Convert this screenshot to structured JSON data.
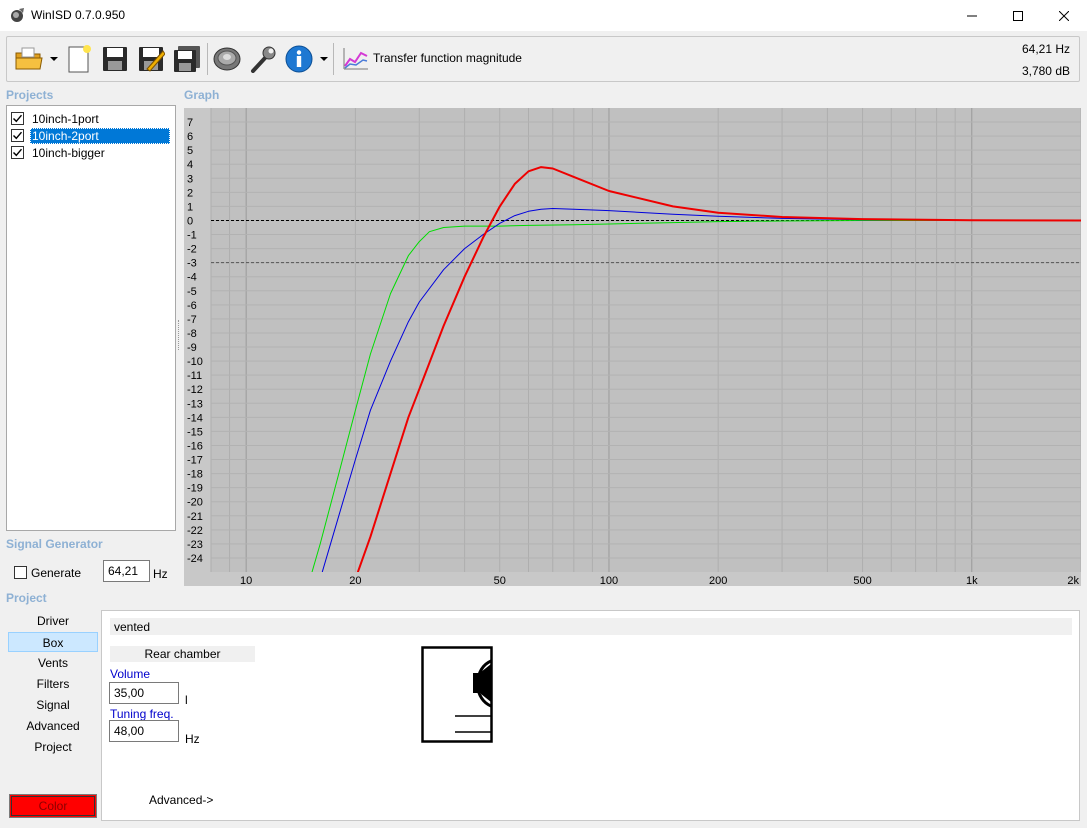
{
  "window": {
    "title": "WinISD 0.7.0.950",
    "minimize_glyph": "—",
    "maximize_glyph": "☐",
    "close_glyph": "✕"
  },
  "toolbar": {
    "buttons": [
      "open-folder-icon",
      "new-project-icon",
      "save-icon",
      "save-as-icon",
      "save-all-icon",
      "driver-icon",
      "tools-icon",
      "info-icon",
      "graph-type-icon"
    ],
    "graph_type_label": "Transfer function magnitude",
    "readout_frequency": "64,21 Hz",
    "readout_level": "3,780 dB"
  },
  "projects": {
    "header": "Projects",
    "items": [
      {
        "label": "10inch-1port",
        "checked": true,
        "selected": false
      },
      {
        "label": "10inch-2port",
        "checked": true,
        "selected": true
      },
      {
        "label": "10inch-bigger",
        "checked": true,
        "selected": false
      }
    ]
  },
  "graph": {
    "header": "Graph"
  },
  "signal_generator": {
    "header": "Signal Generator",
    "generate_label": "Generate",
    "generate_checked": false,
    "frequency_value": "64,21",
    "frequency_unit": "Hz"
  },
  "project_panel": {
    "header": "Project",
    "nav": [
      "Driver",
      "Box",
      "Vents",
      "Filters",
      "Signal",
      "Advanced",
      "Project"
    ],
    "nav_selected": "Box",
    "color_button_label": "Color",
    "color_button_color": "#ff0000",
    "box_type": "vented",
    "rear_chamber_label": "Rear chamber",
    "volume_label": "Volume",
    "volume_value": "35,00",
    "volume_unit": "l",
    "tuning_label": "Tuning freq.",
    "tuning_value": "48,00",
    "tuning_unit": "Hz",
    "advanced_link": "Advanced->"
  },
  "chart_data": {
    "type": "line",
    "x_scale": "log",
    "xlim": [
      8,
      2000
    ],
    "ylim": [
      -25,
      8
    ],
    "x_tick_labels": [
      {
        "value": 10,
        "label": "10"
      },
      {
        "value": 20,
        "label": "20"
      },
      {
        "value": 50,
        "label": "50"
      },
      {
        "value": 100,
        "label": "100"
      },
      {
        "value": 200,
        "label": "200"
      },
      {
        "value": 500,
        "label": "500"
      },
      {
        "value": 1000,
        "label": "1k"
      },
      {
        "value": 2000,
        "label": "2k"
      }
    ],
    "y_ticks": [
      7,
      6,
      5,
      4,
      3,
      2,
      1,
      0,
      -1,
      -2,
      -3,
      -4,
      -5,
      -6,
      -7,
      -8,
      -9,
      -10,
      -11,
      -12,
      -13,
      -14,
      -15,
      -16,
      -17,
      -18,
      -19,
      -20,
      -21,
      -22,
      -23,
      -24
    ],
    "reference_lines": [
      {
        "y": 0,
        "color": "#000000"
      },
      {
        "y": -3,
        "color": "#555555"
      }
    ],
    "background_color": "#c0c0c0",
    "grid": true,
    "series": [
      {
        "color": "#00dd00",
        "width": 1,
        "x": [
          15,
          16,
          18,
          20,
          22,
          25,
          28,
          30,
          32,
          35,
          40,
          45,
          50,
          60,
          80,
          100,
          150,
          200,
          300,
          500,
          1000,
          2000
        ],
        "y": [
          -25.5,
          -23,
          -18,
          -13.5,
          -9.5,
          -5.2,
          -2.5,
          -1.5,
          -0.8,
          -0.5,
          -0.4,
          -0.4,
          -0.4,
          -0.35,
          -0.3,
          -0.25,
          -0.15,
          -0.08,
          -0.04,
          0,
          0,
          0
        ]
      },
      {
        "color": "#0000dd",
        "width": 1,
        "x": [
          16,
          18,
          20,
          22,
          25,
          28,
          30,
          35,
          40,
          45,
          50,
          55,
          60,
          65,
          70,
          80,
          100,
          150,
          200,
          300,
          500,
          1000,
          2000
        ],
        "y": [
          -25.5,
          -21,
          -17,
          -13.5,
          -10,
          -7.2,
          -5.8,
          -3.5,
          -2,
          -1,
          -0.2,
          0.35,
          0.65,
          0.8,
          0.85,
          0.8,
          0.7,
          0.45,
          0.3,
          0.15,
          0.05,
          0.02,
          0
        ]
      },
      {
        "color": "#ee0000",
        "width": 2,
        "x": [
          20,
          22,
          25,
          28,
          30,
          35,
          40,
          45,
          50,
          55,
          60,
          65,
          70,
          80,
          100,
          150,
          200,
          300,
          500,
          1000,
          2000
        ],
        "y": [
          -25.5,
          -22.5,
          -18,
          -14,
          -12,
          -7.5,
          -4,
          -1.2,
          1,
          2.6,
          3.5,
          3.8,
          3.7,
          3.1,
          2.1,
          1,
          0.55,
          0.25,
          0.1,
          0.02,
          0
        ]
      }
    ]
  }
}
